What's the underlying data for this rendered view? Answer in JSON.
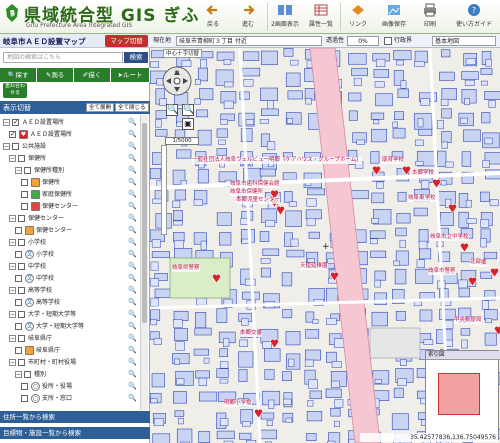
{
  "header": {
    "title": "県域統合型 GIS ぎふ",
    "subtitle": "Gifu Prefecture Area Integrated GIS",
    "toolbar": [
      {
        "label": "戻る",
        "icon": "arrow-left-icon"
      },
      {
        "label": "進む",
        "icon": "arrow-right-icon"
      },
      {
        "label": "2画面表示",
        "icon": "two-screen-icon"
      },
      {
        "label": "属性一覧",
        "icon": "table-icon"
      },
      {
        "label": "リンク",
        "icon": "link-icon"
      },
      {
        "label": "画像保存",
        "icon": "image-save-icon"
      },
      {
        "label": "印刷",
        "icon": "print-icon"
      },
      {
        "label": "使い方ガイド",
        "icon": "guide-icon"
      }
    ]
  },
  "left": {
    "map_title": "岐阜市ＡＥＤ設置マップ",
    "map_switch": "マップ切替",
    "search_placeholder": "地図の検索はこちら",
    "search_button": "検索",
    "nav": [
      "探す",
      "測る",
      "描く",
      "ルート"
    ],
    "overlay_button": "重ね合わせる",
    "layer_header": "表示切替",
    "expand_all": "全て展開",
    "collapse_all": "全て閉じる",
    "tree": [
      {
        "label": "ＡＥＤ設置場所",
        "level": 0,
        "expand": "−",
        "checked": true,
        "sym": "none"
      },
      {
        "label": "ＡＥＤ設置場所",
        "level": 1,
        "expand": "",
        "checked": true,
        "sym": "heart"
      },
      {
        "label": "公共施設",
        "level": 0,
        "expand": "−",
        "checked": false,
        "sym": "none"
      },
      {
        "label": "保健所",
        "level": 1,
        "expand": "−",
        "checked": false,
        "sym": "none"
      },
      {
        "label": "保健所種別",
        "level": 2,
        "expand": "−",
        "checked": false,
        "sym": "none"
      },
      {
        "label": "保健所",
        "level": 3,
        "expand": "",
        "checked": false,
        "sym": "orange"
      },
      {
        "label": "家庭保健所",
        "level": 3,
        "expand": "",
        "checked": false,
        "sym": "green"
      },
      {
        "label": "保健センター",
        "level": 3,
        "expand": "",
        "checked": false,
        "sym": "red"
      },
      {
        "label": "保健センター",
        "level": 1,
        "expand": "−",
        "checked": false,
        "sym": "none"
      },
      {
        "label": "保健センター",
        "level": 2,
        "expand": "",
        "checked": false,
        "sym": "orange"
      },
      {
        "label": "小学校",
        "level": 1,
        "expand": "−",
        "checked": false,
        "sym": "none"
      },
      {
        "label": "小学校",
        "level": 2,
        "expand": "",
        "checked": false,
        "sym": "bun"
      },
      {
        "label": "中学校",
        "level": 1,
        "expand": "−",
        "checked": false,
        "sym": "none"
      },
      {
        "label": "中学校",
        "level": 2,
        "expand": "",
        "checked": false,
        "sym": "bun"
      },
      {
        "label": "高等学校",
        "level": 1,
        "expand": "−",
        "checked": false,
        "sym": "none"
      },
      {
        "label": "高等学校",
        "level": 2,
        "expand": "",
        "checked": false,
        "sym": "bun"
      },
      {
        "label": "大学・短期大学等",
        "level": 1,
        "expand": "−",
        "checked": false,
        "sym": "none"
      },
      {
        "label": "大学・短期大学等",
        "level": 2,
        "expand": "",
        "checked": false,
        "sym": "bun"
      },
      {
        "label": "岐阜県庁",
        "level": 1,
        "expand": "−",
        "checked": false,
        "sym": "none"
      },
      {
        "label": "岐阜県庁",
        "level": 2,
        "expand": "",
        "checked": false,
        "sym": "orange"
      },
      {
        "label": "市町村・町村役場",
        "level": 1,
        "expand": "−",
        "checked": false,
        "sym": "none"
      },
      {
        "label": "種別",
        "level": 2,
        "expand": "−",
        "checked": false,
        "sym": "none"
      },
      {
        "label": "役所・役場",
        "level": 3,
        "expand": "",
        "checked": false,
        "sym": "circle"
      },
      {
        "label": "支所・窓口",
        "level": 3,
        "expand": "",
        "checked": false,
        "sym": "circle"
      }
    ],
    "bottom_bars": [
      "住所一覧から検索",
      "目標物・施設一覧から検索"
    ]
  },
  "map": {
    "location_label": "現在地",
    "location_value": "岐阜市青柳町３丁目 付近",
    "opacity_label": "透過性",
    "opacity_value": "0%",
    "boundary_label": "行政界",
    "base_map": "基本地図",
    "center_move": "中心十字切替",
    "scale": "1/5000",
    "overview_title": "索引図",
    "coordinates": "35.42577836,136.75049576",
    "labels": [
      "一般社団法人岐阜ウェルビュー明郷（ケアハウス・グループホーム）",
      "康育学校",
      "岐阜市歯科保健会館",
      "岐阜市保健所",
      "本郷児童センター",
      "本郷学校",
      "岐阜県警察",
      "天使幼稚園",
      "本郷交番",
      "岐阜市立中学校",
      "岐阜市警察",
      "明郷小学校",
      "市天郷",
      "中央郵便局",
      "北部",
      "岐阜東学校"
    ]
  }
}
